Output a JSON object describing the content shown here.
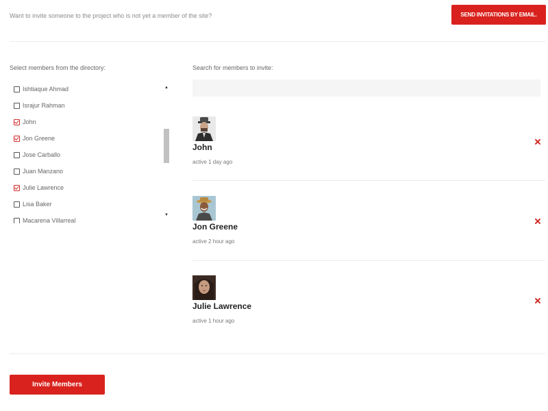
{
  "header": {
    "invite_text": "Want to invite someone to the project who is not yet a member of the site?",
    "email_button_label": "SEND INVITATIONS BY EMAIL."
  },
  "directory": {
    "label": "Select members from the directory:",
    "items": [
      {
        "name": "Ishtiaque Ahmad",
        "checked": false
      },
      {
        "name": "Israjur Rahman",
        "checked": false
      },
      {
        "name": "John",
        "checked": true
      },
      {
        "name": "Jon Greene",
        "checked": true
      },
      {
        "name": "Jose Carballo",
        "checked": false
      },
      {
        "name": "Juan Manzano",
        "checked": false
      },
      {
        "name": "Julie Lawrence",
        "checked": true
      },
      {
        "name": "Lisa Baker",
        "checked": false
      },
      {
        "name": "Macarena Villarreal",
        "checked": false
      }
    ]
  },
  "search": {
    "label": "Search for members to invite:",
    "value": "",
    "placeholder": ""
  },
  "selected_members": [
    {
      "name": "John",
      "activity": "active 1 day ago",
      "avatar": "man-with-hat-avatar"
    },
    {
      "name": "Jon Greene",
      "activity": "active 2 hour ago",
      "avatar": "smiling-man-with-hat-avatar"
    },
    {
      "name": "Julie Lawrence",
      "activity": "active 1 hour ago",
      "avatar": "woman-avatar"
    }
  ],
  "footer": {
    "invite_button_label": "Invite Members"
  },
  "colors": {
    "accent": "#d9221d",
    "remove_icon": "#d0302a",
    "input_bg": "#f5f5f5"
  },
  "icons": {
    "remove": "close-x-icon",
    "scroll_up": "arrow-up-icon",
    "scroll_down": "arrow-down-icon",
    "checkbox": "checkbox-icon"
  }
}
